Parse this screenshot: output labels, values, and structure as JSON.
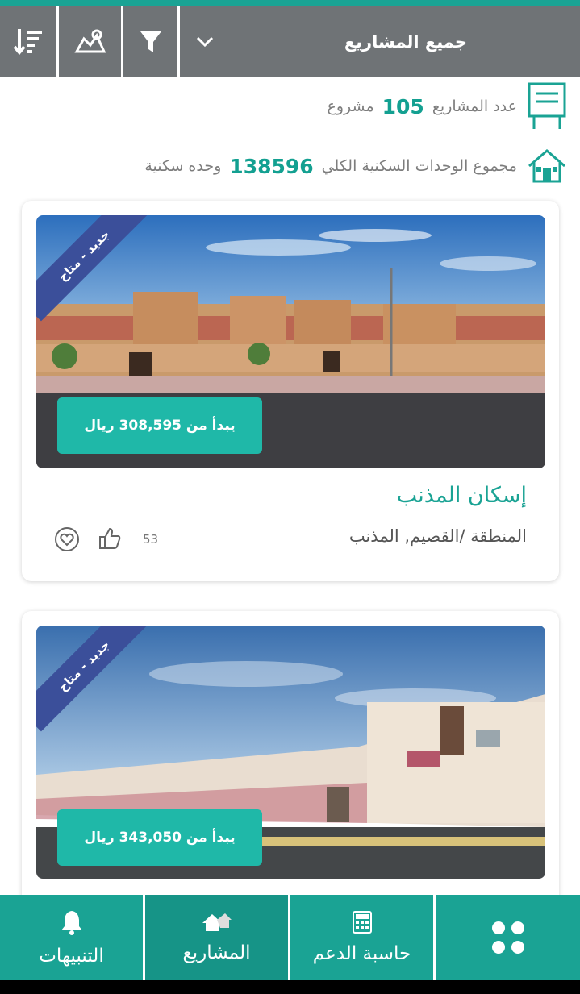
{
  "toolbar": {
    "dropdown_label": "جميع المشاريع",
    "icons": [
      "sort-icon",
      "map-icon",
      "filter-icon",
      "chevron-down-icon"
    ]
  },
  "stats": {
    "projects_prefix": "عدد المشاريع",
    "projects_count": "105",
    "projects_suffix": "مشروع",
    "units_prefix": "مجموع الوحدات السكنية الكلي",
    "units_count": "138596",
    "units_suffix": "وحده سكنية"
  },
  "projects": [
    {
      "badge": "جديد - متاح",
      "price": "يبدأ من 308,595 ريال",
      "name": "إسكان المذنب",
      "region": "المنطقة /القصيم, المذنب",
      "likes": "53"
    },
    {
      "badge": "جديد - متاح",
      "price": "يبدأ من 343,050 ريال"
    }
  ],
  "bottom_nav": {
    "alerts": "التنبيهات",
    "projects": "المشاريع",
    "calculator": "حاسبة الدعم"
  },
  "colors": {
    "accent": "#1aa394",
    "button": "#1fb8a8",
    "ribbon": "#3b4f9a",
    "toolbar": "#6f7376"
  }
}
